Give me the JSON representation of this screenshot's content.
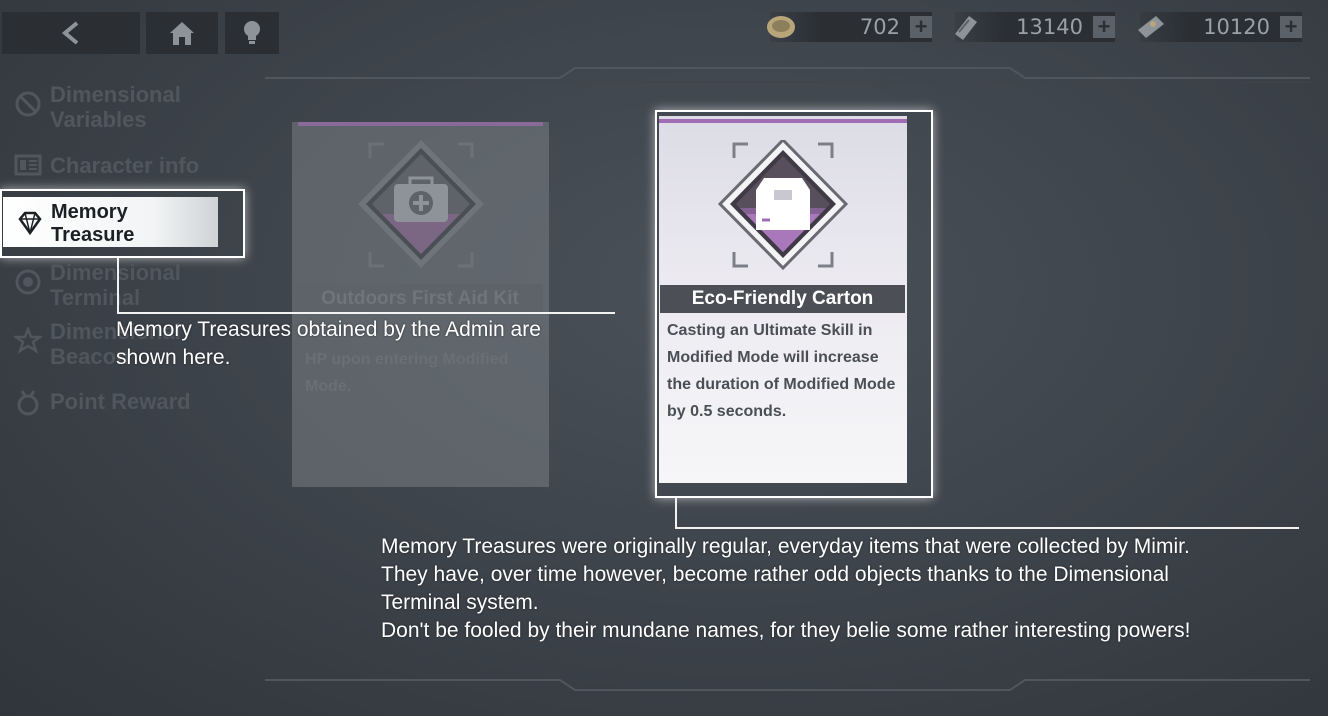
{
  "topbar": {
    "back_icon": "chevron-left-icon",
    "home_icon": "home-icon",
    "hint_icon": "lightbulb-icon",
    "resources": [
      {
        "icon": "coin-icon",
        "value": "702",
        "plus": "+"
      },
      {
        "icon": "crystal-icon",
        "value": "13140",
        "plus": "+"
      },
      {
        "icon": "ticket-icon",
        "value": "10120",
        "plus": "+"
      }
    ]
  },
  "sidebar": {
    "items": [
      {
        "label_1": "Dimensional",
        "label_2": "Variables",
        "icon": "variables-icon"
      },
      {
        "label_1": "Character info",
        "icon": "character-info-icon"
      },
      {
        "label_1": "Memory",
        "label_2": "Treasure",
        "icon": "diamond-icon"
      },
      {
        "label_1": "Dimensional",
        "label_2": "Terminal",
        "icon": "terminal-icon"
      },
      {
        "label_1": "Dimensional",
        "label_2": "Beacon",
        "icon": "beacon-icon"
      },
      {
        "label_1": "Point Reward",
        "icon": "reward-icon"
      }
    ]
  },
  "cards": [
    {
      "title": "Outdoors First Aid Kit",
      "icon": "first-aid-kit-icon",
      "desc": "HP upon entering Modified Mode."
    },
    {
      "title": "Eco-Friendly Carton",
      "icon": "carton-icon",
      "desc": "Casting an Ultimate Skill in Modified Mode will increase the duration of Modified Mode by 0.5 seconds."
    }
  ],
  "callouts": {
    "sidebar_text_1": "Memory Treasures obtained by the Admin are",
    "sidebar_text_2": "shown here.",
    "card_text_1": "Memory Treasures were originally regular, everyday items that were collected by Mimir.",
    "card_text_2": "They have, over time however, become rather odd objects thanks to the Dimensional",
    "card_text_3": "Terminal system.",
    "card_text_4": "Don't be fooled by their mundane names, for they belie some rather interesting powers!"
  },
  "colors": {
    "highlight": "#ffffff",
    "accent_purple": "#a06db5"
  }
}
